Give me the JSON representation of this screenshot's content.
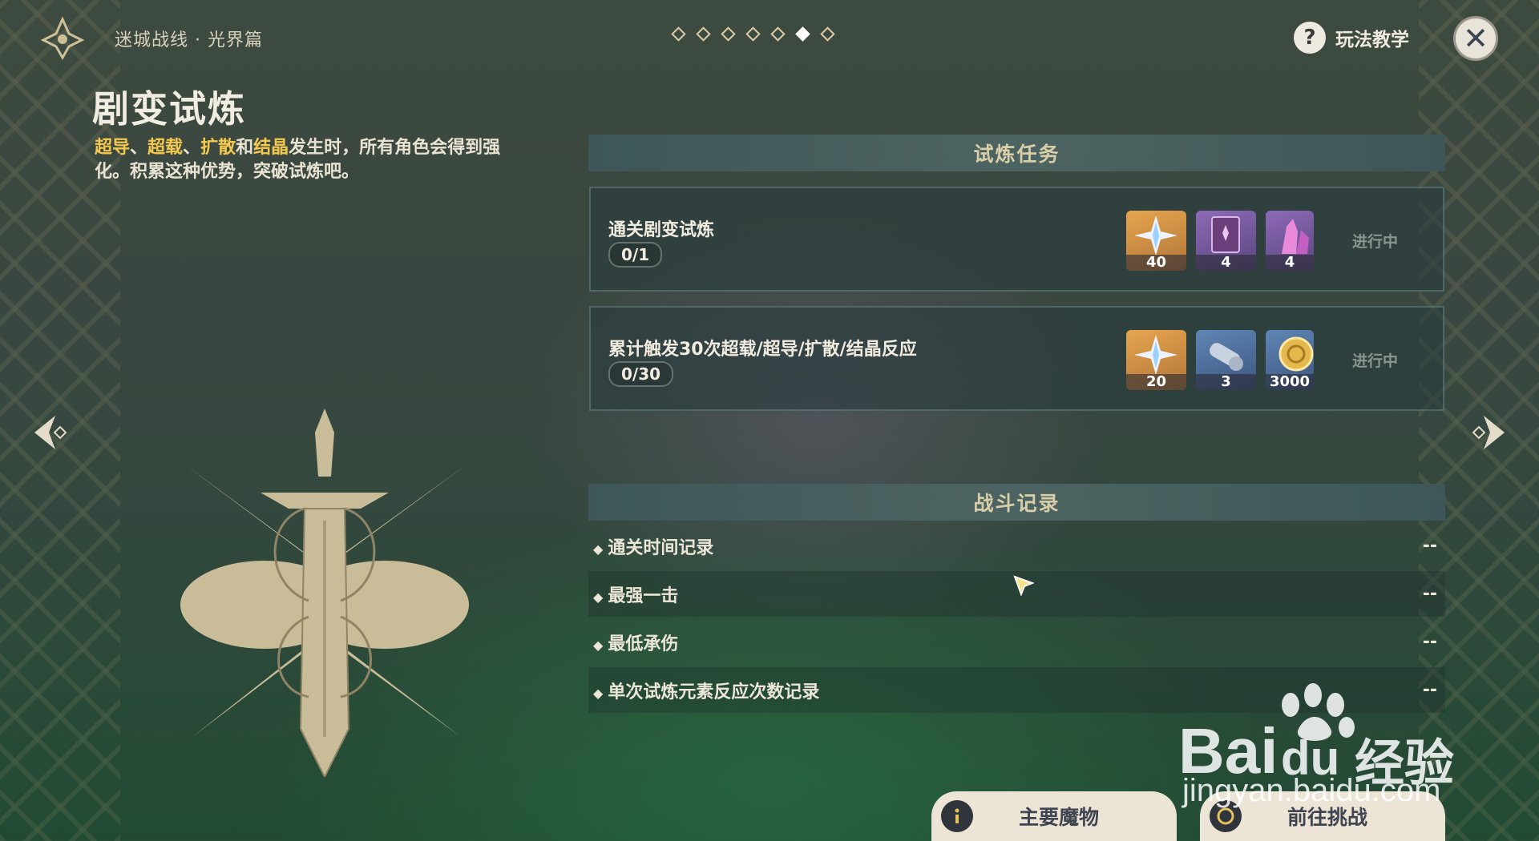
{
  "header": {
    "breadcrumb": "迷城战线 · 光界篇",
    "page_dots_total": 7,
    "page_dots_active": 6,
    "help_label": "玩法教学"
  },
  "trial": {
    "title": "剧变试炼",
    "desc_hl_1": "超导",
    "desc_sep_1": "、",
    "desc_hl_2": "超载",
    "desc_sep_2": "、",
    "desc_hl_3": "扩散",
    "desc_sep_3": "和",
    "desc_hl_4": "结晶",
    "desc_rest": "发生时，所有角色会得到强化。积累这种优势，突破试炼吧。"
  },
  "tasks": {
    "header": "试炼任务",
    "items": [
      {
        "name": "通关剧变试炼",
        "progress": "0/1",
        "status": "进行中",
        "rewards": [
          "40",
          "4",
          "4"
        ],
        "reward_icons": [
          "primogem-icon",
          "wanderers-advice-book-icon",
          "crystal-ore-icon"
        ]
      },
      {
        "name": "累计触发30次超载/超导/扩散/结晶反应",
        "progress": "0/30",
        "status": "进行中",
        "rewards": [
          "20",
          "3",
          "3000"
        ],
        "reward_icons": [
          "primogem-icon",
          "mystic-enhancement-ore-icon",
          "mora-icon"
        ]
      }
    ]
  },
  "records": {
    "header": "战斗记录",
    "items": [
      {
        "label": "通关时间记录",
        "value": "--"
      },
      {
        "label": "最强一击",
        "value": "--"
      },
      {
        "label": "最低承伤",
        "value": "--"
      },
      {
        "label": "单次试炼元素反应次数记录",
        "value": "--"
      }
    ]
  },
  "buttons": {
    "monsters": "主要魔物",
    "challenge": "前往挑战"
  },
  "watermark": {
    "brand": "Bai",
    "brand2": "du",
    "cn": "经验",
    "url": "jingyan.baidu.com"
  },
  "colors": {
    "highlight": "#f3c94e",
    "panel_header": "#4e6664",
    "button_bg": "#ece5d6"
  }
}
